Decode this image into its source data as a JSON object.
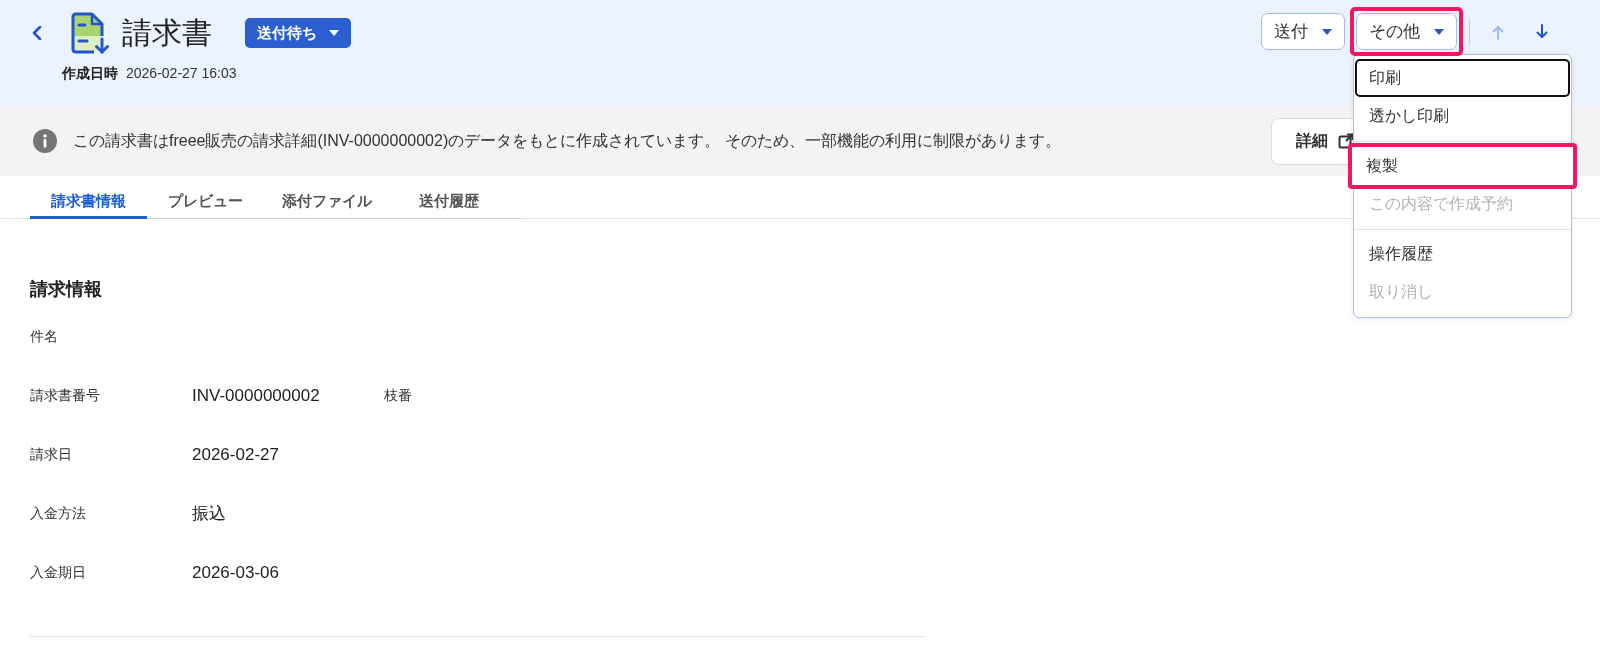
{
  "header": {
    "title": "請求書",
    "status": {
      "label": "送付待ち"
    },
    "created": {
      "label": "作成日時",
      "value": "2026-02-27 16:03"
    },
    "actions": [
      {
        "label": "送付",
        "highlighted": false
      },
      {
        "label": "その他",
        "highlighted": true,
        "expanded": true,
        "menu": {
          "groups": [
            {
              "items": [
                {
                  "label": "印刷",
                  "focused": true,
                  "disabled": false,
                  "highlighted": false
                },
                {
                  "label": "透かし印刷",
                  "focused": false,
                  "disabled": false,
                  "highlighted": false
                }
              ]
            },
            {
              "items": [
                {
                  "label": "複製",
                  "focused": false,
                  "disabled": false,
                  "highlighted": true
                },
                {
                  "label": "この内容で作成予約",
                  "focused": false,
                  "disabled": true,
                  "highlighted": false
                }
              ]
            },
            {
              "items": [
                {
                  "label": "操作履歴",
                  "focused": false,
                  "disabled": false,
                  "highlighted": false
                },
                {
                  "label": "取り消し",
                  "focused": false,
                  "disabled": true,
                  "highlighted": false
                }
              ]
            }
          ]
        }
      }
    ],
    "nav": [
      {
        "kind": "up",
        "disabled": true
      },
      {
        "kind": "down",
        "disabled": false
      }
    ]
  },
  "notice": {
    "message": "この請求書はfreee販売の請求詳細(INV-0000000002)のデータをもとに作成されています。 そのため、一部機能の利用に制限があります。",
    "button": {
      "label": "詳細"
    }
  },
  "tabs": [
    {
      "label": "請求書情報",
      "selected": true
    },
    {
      "label": "プレビュー",
      "selected": false
    },
    {
      "label": "添付ファイル",
      "selected": false
    },
    {
      "label": "送付履歴",
      "selected": false
    }
  ],
  "section": {
    "title": "請求情報",
    "fields": [
      {
        "label": "件名"
      },
      {
        "label": "請求書番号",
        "value": "INV-0000000002",
        "sub_label": "枝番"
      },
      {
        "label": "請求日",
        "value": "2026-02-27"
      },
      {
        "label": "入金方法",
        "value": "振込"
      },
      {
        "label": "入金期日",
        "value": "2026-03-06"
      }
    ]
  }
}
